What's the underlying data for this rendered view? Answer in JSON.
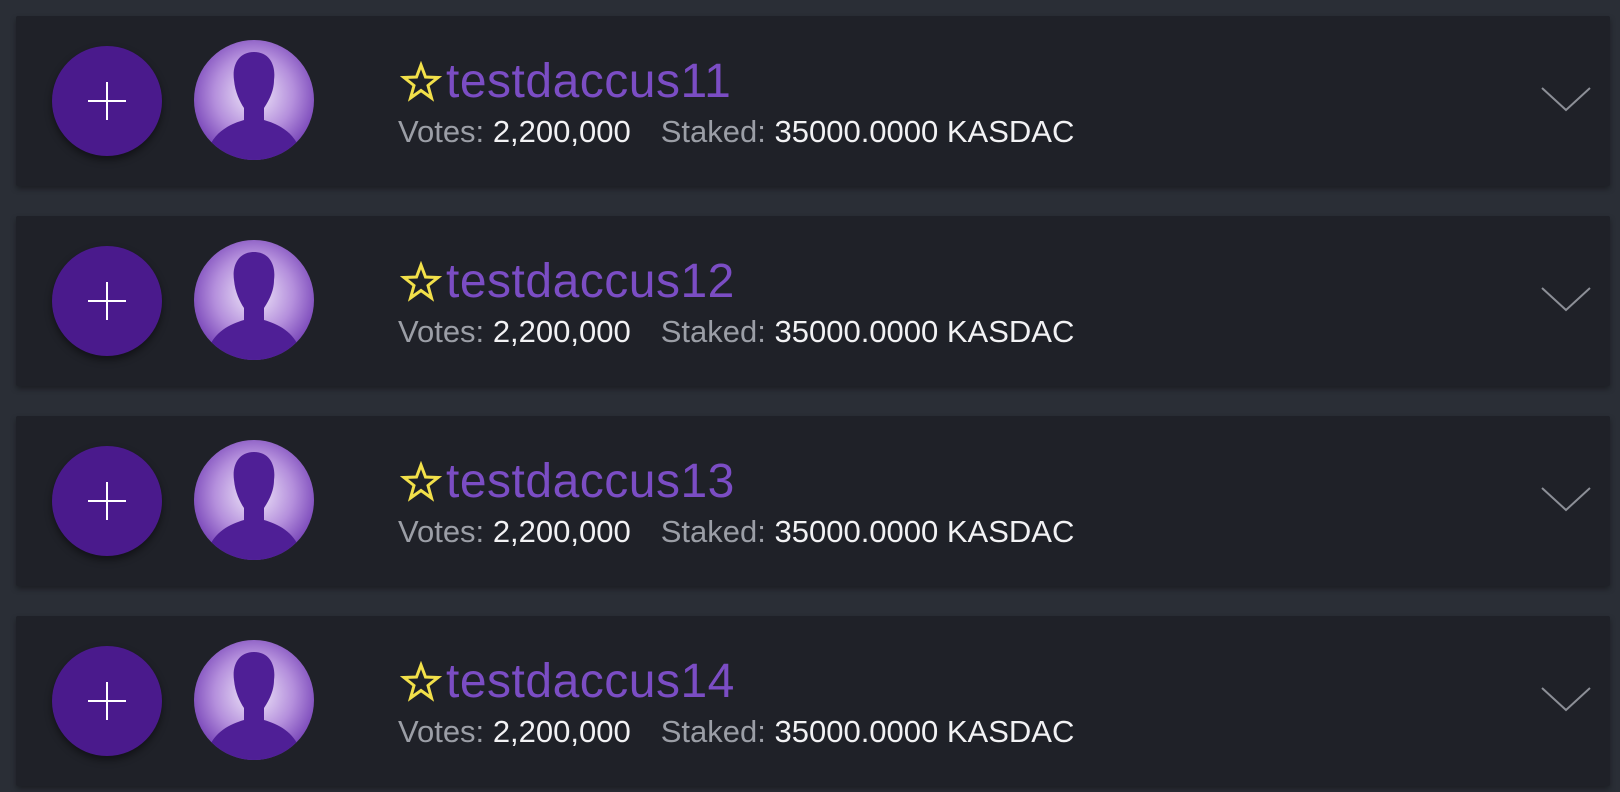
{
  "labels": {
    "votes": "Votes:",
    "staked": "Staked:"
  },
  "colors": {
    "background": "#2a2e36",
    "card": "#1f2128",
    "accent": "#4a1a8c",
    "name": "#7b4dc4",
    "star": "#f2e04a"
  },
  "icons": {
    "add": "plus-icon",
    "favorite": "star-outline-icon",
    "avatar": "person-silhouette-icon",
    "expand": "chevron-down-icon"
  },
  "producers": [
    {
      "name": "testdaccus11",
      "votes": "2,200,000",
      "staked": "35000.0000 KASDAC"
    },
    {
      "name": "testdaccus12",
      "votes": "2,200,000",
      "staked": "35000.0000 KASDAC"
    },
    {
      "name": "testdaccus13",
      "votes": "2,200,000",
      "staked": "35000.0000 KASDAC"
    },
    {
      "name": "testdaccus14",
      "votes": "2,200,000",
      "staked": "35000.0000 KASDAC"
    }
  ]
}
